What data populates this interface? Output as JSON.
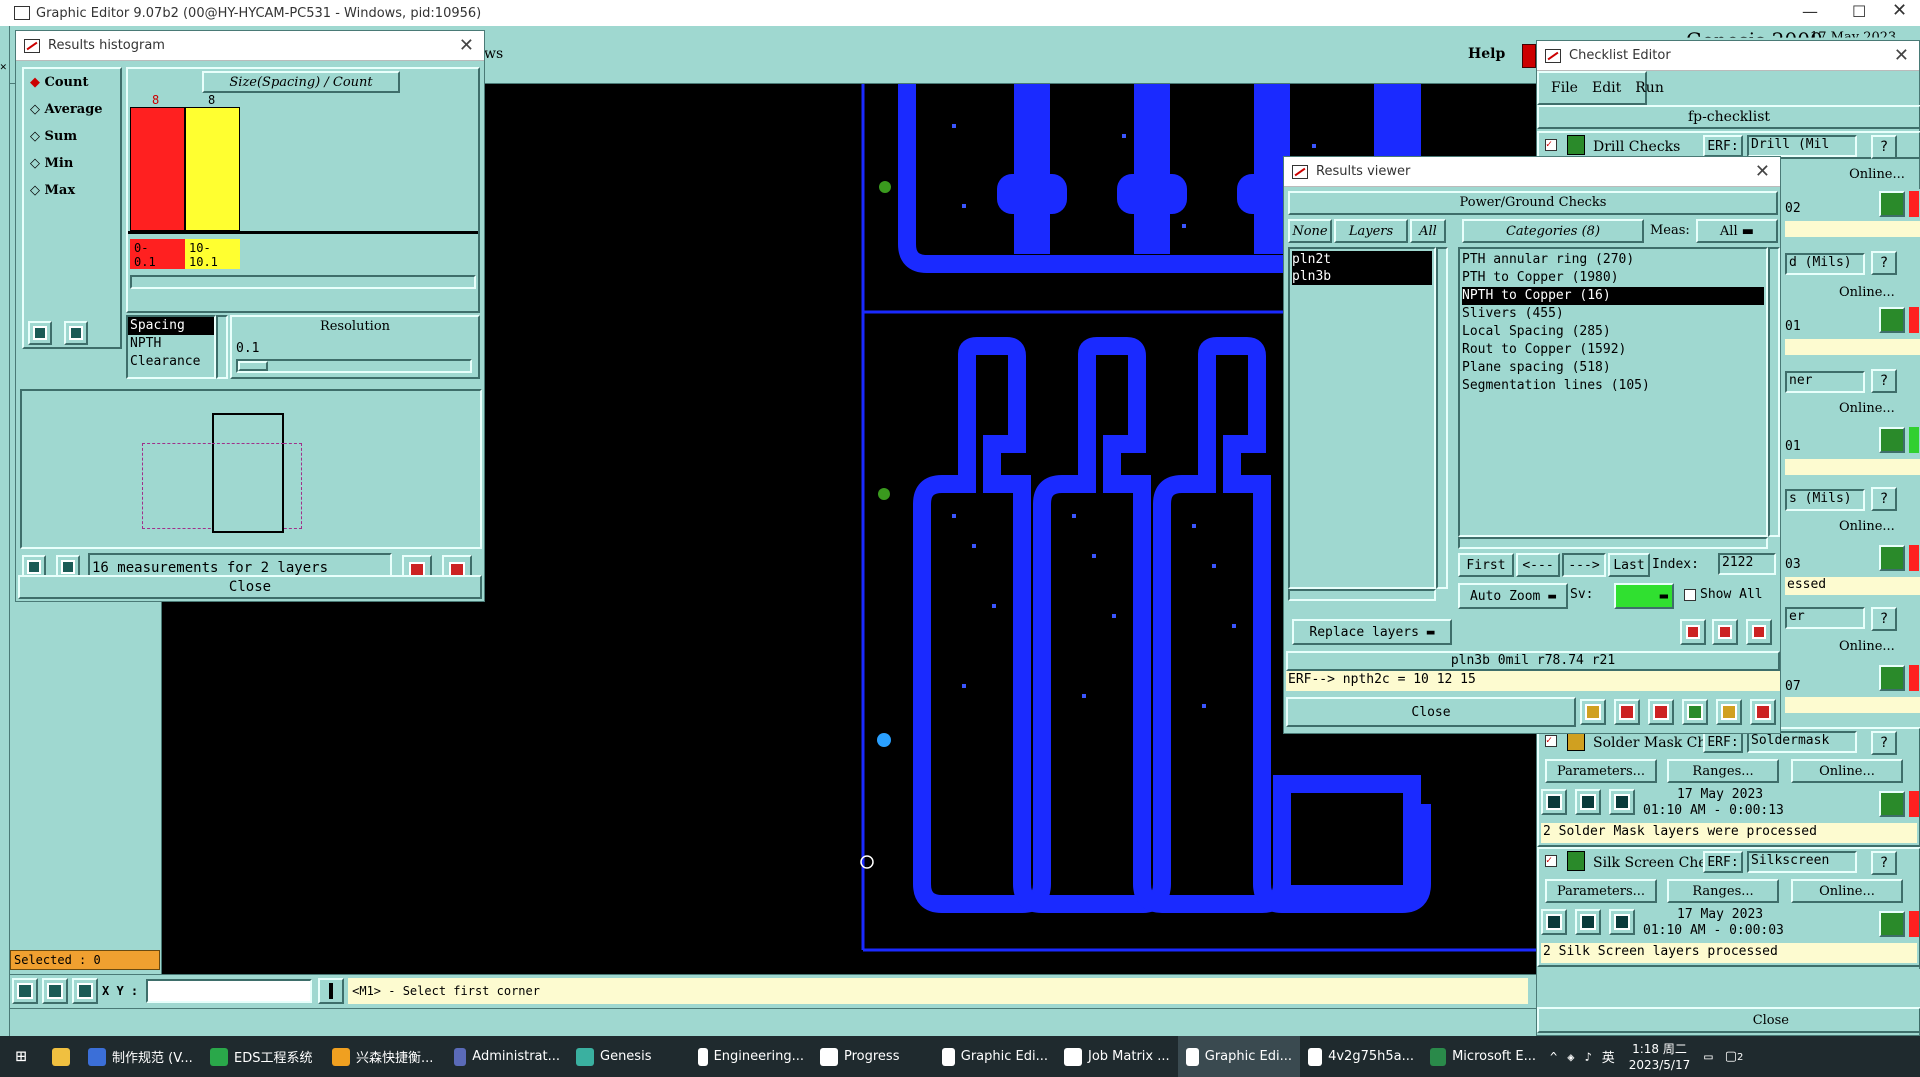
{
  "app_title": "Graphic Editor 9.07b2 (00@HY-HYCAM-PC531 - Windows, pid:10956)",
  "main": {
    "help": "Help",
    "ws_partial": "ws",
    "selected": "Selected : 0",
    "xy_label": "X Y :",
    "xy_value": "",
    "status_msg": "<M1> - Select first corner",
    "title_partial": "Ge...",
    "date_partial": "17 May 2023"
  },
  "histogram": {
    "title": "Results histogram",
    "modes": [
      "Count",
      "Average",
      "Sum",
      "Min",
      "Max"
    ],
    "axis_label": "Size(Spacing) / Count",
    "bars": [
      {
        "count": "8",
        "range": "0-\n0.1",
        "color": "#ff2020"
      },
      {
        "count": "8",
        "range": "10-\n10.1",
        "color": "#ffff30"
      }
    ],
    "list": [
      "Spacing",
      "NPTH",
      "Clearance"
    ],
    "resolution_label": "Resolution",
    "resolution_value": "0.1",
    "summary": "16 measurements for 2 layers",
    "close": "Close"
  },
  "results_viewer": {
    "title": "Results viewer",
    "header": "Power/Ground Checks",
    "btn_none": "None",
    "btn_layers": "Layers",
    "btn_all": "All",
    "categories_btn": "Categories (8)",
    "meas_label": "Meas:",
    "meas_value": "All",
    "layers": [
      "pln2t",
      "pln3b"
    ],
    "categories": [
      "PTH annular ring (270)",
      "PTH to Copper (1980)",
      "NPTH to Copper (16)",
      "Slivers (455)",
      "Local Spacing (285)",
      "Rout to Copper (1592)",
      "Plane spacing (518)",
      "Segmentation lines (105)"
    ],
    "selected_category": 2,
    "nav": {
      "first": "First",
      "prev": "<---",
      "next": "--->",
      "last": "Last",
      "index_label": "Index:",
      "index_value": "2122"
    },
    "auto_zoom": "Auto Zoom",
    "sv": "Sv:",
    "show_all": "Show All",
    "replace_layers": "Replace layers",
    "info_line": "pln3b 0mil  r78.74  r21",
    "erf_line": "ERF--> npth2c = 10 12 15",
    "close": "Close"
  },
  "checklist": {
    "title": "Checklist Editor",
    "menu": [
      "File",
      "Edit",
      "Run"
    ],
    "name": "fp-checklist",
    "drill": {
      "label": "Drill Checks",
      "erf": "ERF:",
      "erf_value": "Drill (Mil",
      "online": "Online...",
      "time_partial": "02"
    },
    "partials": [
      "d (Mils)",
      "Online...",
      "01",
      "ner",
      "Online...",
      "01",
      "s (Mils)",
      "Online...",
      "03",
      "essed",
      "er",
      "Online...",
      "07"
    ],
    "solder": {
      "label": "Solder Mask Ch",
      "erf": "ERF:",
      "erf_value": "Soldermask",
      "params": "Parameters...",
      "ranges": "Ranges...",
      "online": "Online...",
      "date": "17 May 2023",
      "time": "01:10 AM - 0:00:13",
      "status": "2 Solder Mask layers were processed"
    },
    "silk": {
      "label": "Silk Screen Che",
      "erf": "ERF:",
      "erf_value": "Silkscreen",
      "params": "Parameters...",
      "ranges": "Ranges...",
      "online": "Online...",
      "date": "17 May 2023",
      "time": "01:10 AM - 0:00:03",
      "status": "2 Silk Screen layers processed"
    },
    "close": "Close"
  },
  "taskbar": {
    "items": [
      {
        "label": "制作规范 (V...",
        "color": "#3b6fd8"
      },
      {
        "label": "EDS工程系统",
        "color": "#2aa84a"
      },
      {
        "label": "兴森快捷衡...",
        "color": "#f0a020"
      },
      {
        "label": "Administrat...",
        "color": "#5a6ab8"
      },
      {
        "label": "Genesis",
        "color": "#3ab0a0"
      },
      {
        "label": "Engineering...",
        "color": "#ffffff"
      },
      {
        "label": "Progress",
        "color": "#ffffff"
      },
      {
        "label": "Graphic Edi...",
        "color": "#ffffff"
      },
      {
        "label": "Job Matrix ...",
        "color": "#ffffff"
      },
      {
        "label": "Graphic Edi...",
        "color": "#ffffff"
      },
      {
        "label": "4v2g75h5a...",
        "color": "#ffffff"
      },
      {
        "label": "Microsoft E...",
        "color": "#2a8a4a"
      }
    ],
    "time": "1:18 周二",
    "date": "2023/5/17",
    "ime": "英",
    "notif": "2"
  }
}
